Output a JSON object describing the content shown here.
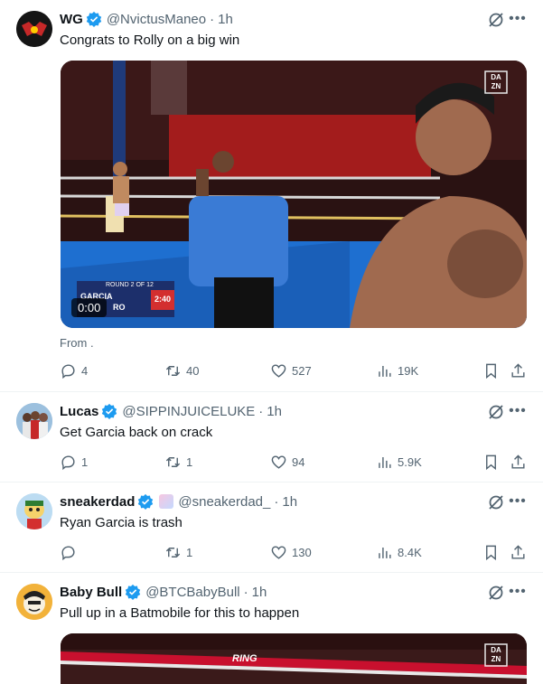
{
  "tweets": [
    {
      "name": "WG",
      "handle": "@NvictusManeo",
      "time": "1h",
      "text": "Congrats to Rolly on a big win",
      "from": "From .",
      "video_time": "0:00",
      "overlay": {
        "round": "ROUND 2 OF 12",
        "fighter1": "GARCIA",
        "fighter2": "RO",
        "clock": "2:40",
        "dazn": "DA ZN"
      },
      "stats": {
        "replies": "4",
        "reposts": "40",
        "likes": "527",
        "views": "19K"
      }
    },
    {
      "name": "Lucas",
      "handle": "@SIPPINJUICELUKE",
      "time": "1h",
      "text": "Get Garcia back on crack",
      "stats": {
        "replies": "1",
        "reposts": "1",
        "likes": "94",
        "views": "5.9K"
      }
    },
    {
      "name": "sneakerdad",
      "handle": "@sneakerdad_",
      "time": "1h",
      "text": "Ryan Garcia is trash",
      "stats": {
        "replies": "",
        "reposts": "1",
        "likes": "130",
        "views": "8.4K"
      }
    },
    {
      "name": "Baby Bull",
      "handle": "@BTCBabyBull",
      "time": "1h",
      "text": "Pull up in a Batmobile for this to happen",
      "overlay": {
        "ring": "RING",
        "dazn": "DA ZN"
      }
    }
  ],
  "colors": {
    "verified": "#1d9bf0",
    "muted": "#536471",
    "ring_blue": "#1565c0",
    "referee_shirt": "#3a7bd5"
  },
  "icons": [
    "verified-badge-icon",
    "grok-icon",
    "more-icon",
    "reply-icon",
    "repost-icon",
    "like-icon",
    "views-icon",
    "bookmark-icon",
    "share-icon"
  ]
}
